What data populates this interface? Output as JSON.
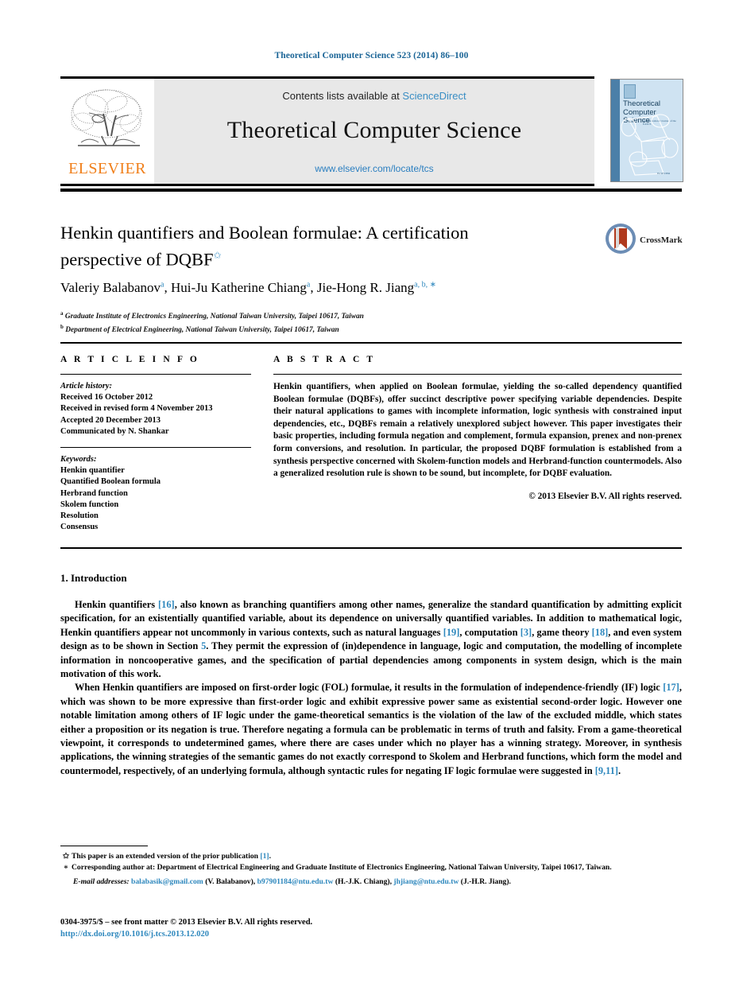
{
  "running_head": "Theoretical Computer Science 523 (2014) 86–100",
  "masthead": {
    "contents_prefix": "Contents lists available at ",
    "sciencedirect": "ScienceDirect",
    "journal_name": "Theoretical Computer Science",
    "journal_url": "www.elsevier.com/locate/tcs",
    "publisher": "ELSEVIER"
  },
  "cover": {
    "title": "Theoretical Computer Science",
    "subtitle": "An International Journal of the EATCS",
    "footer": "ELSEVIER"
  },
  "article": {
    "title": "Henkin quantifiers and Boolean formulae: A certification perspective of DQBF",
    "title_line1": "Henkin quantifiers and Boolean formulae: A certification",
    "title_line2": "perspective of DQBF",
    "title_footnote_mark": "✩",
    "crossmark_label": "CrossMark",
    "authors": [
      {
        "name": "Valeriy Balabanov",
        "sup": "a"
      },
      {
        "name": "Hui-Ju Katherine Chiang",
        "sup": "a"
      },
      {
        "name": "Jie-Hong R. Jiang",
        "sup": "a, b, ∗"
      }
    ],
    "affiliations": [
      {
        "mark": "a",
        "text": "Graduate Institute of Electronics Engineering, National Taiwan University, Taipei 10617, Taiwan"
      },
      {
        "mark": "b",
        "text": "Department of Electrical Engineering, National Taiwan University, Taipei 10617, Taiwan"
      }
    ]
  },
  "article_info": {
    "heading": "A R T I C L E    I N F O",
    "history_label": "Article history:",
    "history": [
      "Received 16 October 2012",
      "Received in revised form 4 November 2013",
      "Accepted 20 December 2013",
      "Communicated by N. Shankar"
    ],
    "keywords_label": "Keywords:",
    "keywords": [
      "Henkin quantifier",
      "Quantified Boolean formula",
      "Herbrand function",
      "Skolem function",
      "Resolution",
      "Consensus"
    ]
  },
  "abstract": {
    "heading": "A B S T R A C T",
    "text": "Henkin quantifiers, when applied on Boolean formulae, yielding the so-called dependency quantified Boolean formulae (DQBFs), offer succinct descriptive power specifying variable dependencies. Despite their natural applications to games with incomplete information, logic synthesis with constrained input dependencies, etc., DQBFs remain a relatively unexplored subject however. This paper investigates their basic properties, including formula negation and complement, formula expansion, prenex and non-prenex form conversions, and resolution. In particular, the proposed DQBF formulation is established from a synthesis perspective concerned with Skolem-function models and Herbrand-function countermodels. Also a generalized resolution rule is shown to be sound, but incomplete, for DQBF evaluation.",
    "copyright": "© 2013 Elsevier B.V. All rights reserved."
  },
  "body": {
    "section1_title": "1. Introduction",
    "paragraph1": {
      "seg1": "Henkin quantifiers ",
      "ref1": "[16]",
      "seg2": ", also known as branching quantifiers among other names, generalize the standard quantification by admitting explicit specification, for an existentially quantified variable, about its dependence on universally quantified variables. In addition to mathematical logic, Henkin quantifiers appear not uncommonly in various contexts, such as natural languages ",
      "ref2": "[19]",
      "seg3": ", computation ",
      "ref3": "[3]",
      "seg4": ", game theory ",
      "ref4": "[18]",
      "seg5": ", and even system design as to be shown in Section ",
      "ref5": "5",
      "seg6": ". They permit the expression of (in)dependence in language, logic and computation, the modelling of incomplete information in noncooperative games, and the specification of partial dependencies among components in system design, which is the main motivation of this work."
    },
    "paragraph2": {
      "seg1": "When Henkin quantifiers are imposed on first-order logic (FOL) formulae, it results in the formulation of independence-friendly (IF) logic ",
      "ref1": "[17]",
      "seg2": ", which was shown to be more expressive than first-order logic and exhibit expressive power same as existential second-order logic. However one notable limitation among others of IF logic under the game-theoretical semantics is the violation of the law of the excluded middle, which states either a proposition or its negation is true. Therefore negating a formula can be problematic in terms of truth and falsity. From a game-theoretical viewpoint, it corresponds to undetermined games, where there are cases under which no player has a winning strategy. Moreover, in synthesis applications, the winning strategies of the semantic games do not exactly correspond to Skolem and Herbrand functions, which form the model and countermodel, respectively, of an underlying formula, although syntactic rules for negating IF logic formulae were suggested in ",
      "ref2": "[9,11]",
      "seg3": "."
    }
  },
  "footnotes": {
    "note1_mark": "✩",
    "note1_text": "This paper is an extended version of the prior publication ",
    "note1_ref": "[1]",
    "note1_end": ".",
    "note2_mark": "∗",
    "note2_text": "Corresponding author at: Department of Electrical Engineering and Graduate Institute of Electronics Engineering, National Taiwan University, Taipei 10617, Taiwan.",
    "email_label": "E-mail addresses:",
    "emails": [
      {
        "address": "balabasik@gmail.com",
        "owner": "(V. Balabanov)"
      },
      {
        "address": "b97901184@ntu.edu.tw",
        "owner": "(H.-J.K. Chiang)"
      },
      {
        "address": "jhjiang@ntu.edu.tw",
        "owner": "(J.-H.R. Jiang)"
      }
    ]
  },
  "footer": {
    "issn_line": "0304-3975/$ – see front matter © 2013 Elsevier B.V. All rights reserved.",
    "doi": "http://dx.doi.org/10.1016/j.tcs.2013.12.020"
  },
  "colors": {
    "link_blue": "#2d87bd",
    "header_blue": "#1a6496",
    "elsevier_orange": "#F07F1A",
    "masthead_gray": "#e8e8e8"
  }
}
